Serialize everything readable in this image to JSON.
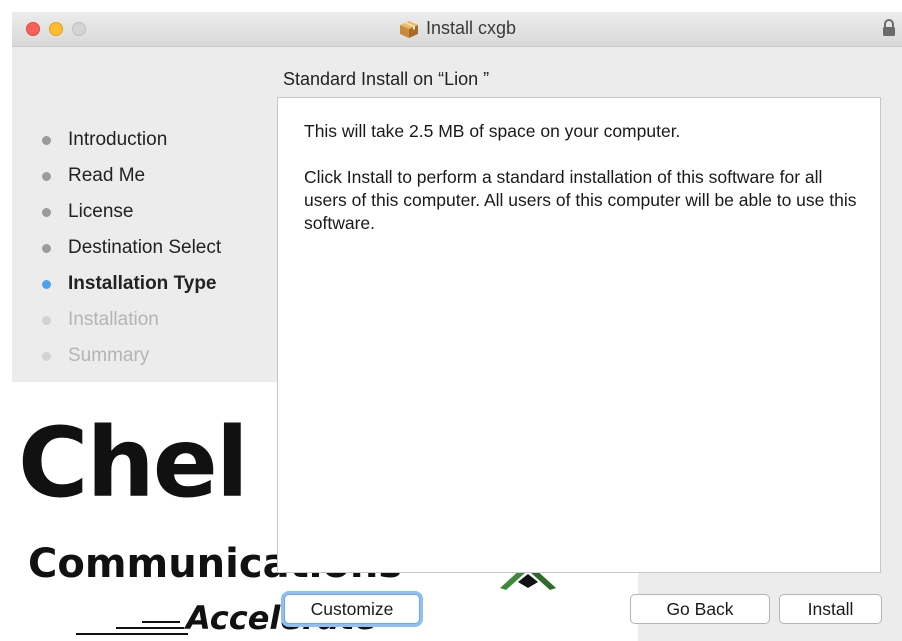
{
  "window": {
    "title": "Install cxgb",
    "title_icon": "package-icon",
    "lock_icon": "lock-icon"
  },
  "heading": "Standard Install on “Lion ”",
  "steps": [
    {
      "label": "Introduction",
      "state": "done"
    },
    {
      "label": "Read Me",
      "state": "done"
    },
    {
      "label": "License",
      "state": "done"
    },
    {
      "label": "Destination Select",
      "state": "done"
    },
    {
      "label": "Installation Type",
      "state": "current"
    },
    {
      "label": "Installation",
      "state": "future"
    },
    {
      "label": "Summary",
      "state": "future"
    }
  ],
  "content": {
    "space_text": "This will take 2.5 MB of space on your computer.",
    "description": "Click Install to perform a standard installation of this software for all users of this computer. All users of this computer will be able to use this software."
  },
  "brand": {
    "name": "Chel",
    "sub": "Communications",
    "tagline": "Accelerate"
  },
  "buttons": {
    "customize": "Customize",
    "go_back": "Go Back",
    "install": "Install"
  },
  "colors": {
    "close": "#fc5f57",
    "minimize": "#fdbc2e",
    "current_step_dot": "#4aa3f0",
    "focus_ring": "#8ec0f3"
  }
}
